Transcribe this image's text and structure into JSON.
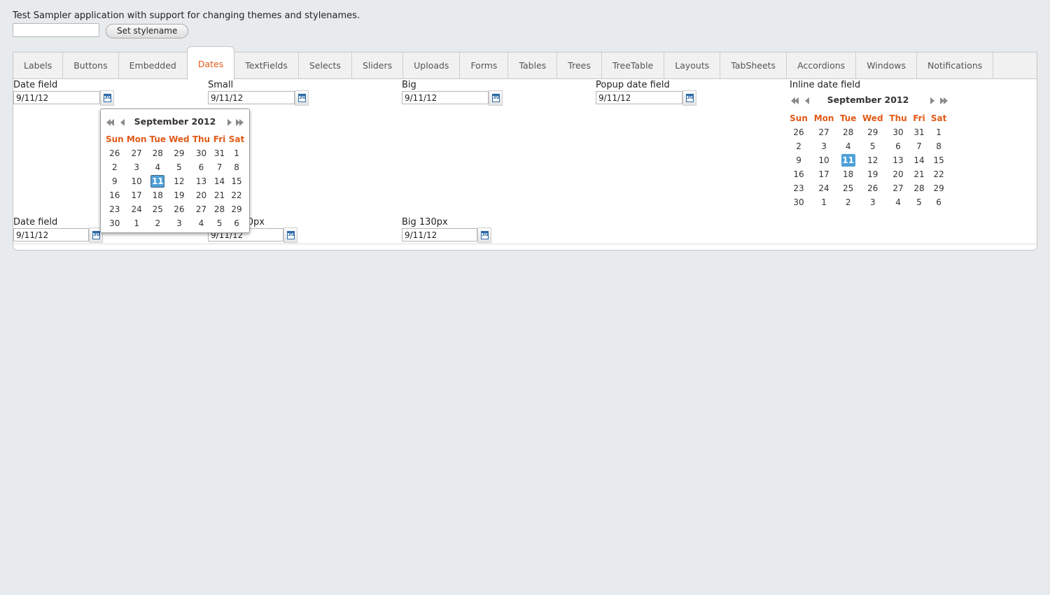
{
  "intro_text": "Test Sampler application with support for changing themes and stylenames.",
  "stylename_input": {
    "value": ""
  },
  "set_stylename_label": "Set stylename",
  "tabs": [
    {
      "label": "Labels"
    },
    {
      "label": "Buttons"
    },
    {
      "label": "Embedded"
    },
    {
      "label": "Dates",
      "active": true
    },
    {
      "label": "TextFields"
    },
    {
      "label": "Selects"
    },
    {
      "label": "Sliders"
    },
    {
      "label": "Uploads"
    },
    {
      "label": "Forms"
    },
    {
      "label": "Tables"
    },
    {
      "label": "Trees"
    },
    {
      "label": "TreeTable"
    },
    {
      "label": "Layouts"
    },
    {
      "label": "TabSheets"
    },
    {
      "label": "Accordions"
    },
    {
      "label": "Windows"
    },
    {
      "label": "Notifications"
    }
  ],
  "fields": {
    "date_field": {
      "label": "Date field",
      "value": "9/11/12"
    },
    "small": {
      "label": "Small",
      "value": "9/11/12"
    },
    "big": {
      "label": "Big",
      "value": "9/11/12"
    },
    "popup_date_field": {
      "label": "Popup date field",
      "value": "9/11/12"
    },
    "inline_date_field": {
      "label": "Inline date field"
    },
    "date_field_2": {
      "label": "Date field",
      "value": "9/11/12"
    },
    "small_130": {
      "label": "Small 130px",
      "value": "9/11/12"
    },
    "big_130": {
      "label": "Big 130px",
      "value": "9/11/12"
    }
  },
  "calendar_icon_text": "30",
  "calendar": {
    "month_year": "September 2012",
    "weekdays": [
      "Sun",
      "Mon",
      "Tue",
      "Wed",
      "Thu",
      "Fri",
      "Sat"
    ],
    "weeks": [
      [
        "26",
        "27",
        "28",
        "29",
        "30",
        "31",
        "1"
      ],
      [
        "2",
        "3",
        "4",
        "5",
        "6",
        "7",
        "8"
      ],
      [
        "9",
        "10",
        "11",
        "12",
        "13",
        "14",
        "15"
      ],
      [
        "16",
        "17",
        "18",
        "19",
        "20",
        "21",
        "22"
      ],
      [
        "23",
        "24",
        "25",
        "26",
        "27",
        "28",
        "29"
      ],
      [
        "30",
        "1",
        "2",
        "3",
        "4",
        "5",
        "6"
      ]
    ],
    "selected_day": "11"
  },
  "colors": {
    "accent": "#e05a17",
    "selected": "#4ea0d8",
    "icon_blue": "#2c6aa8"
  }
}
